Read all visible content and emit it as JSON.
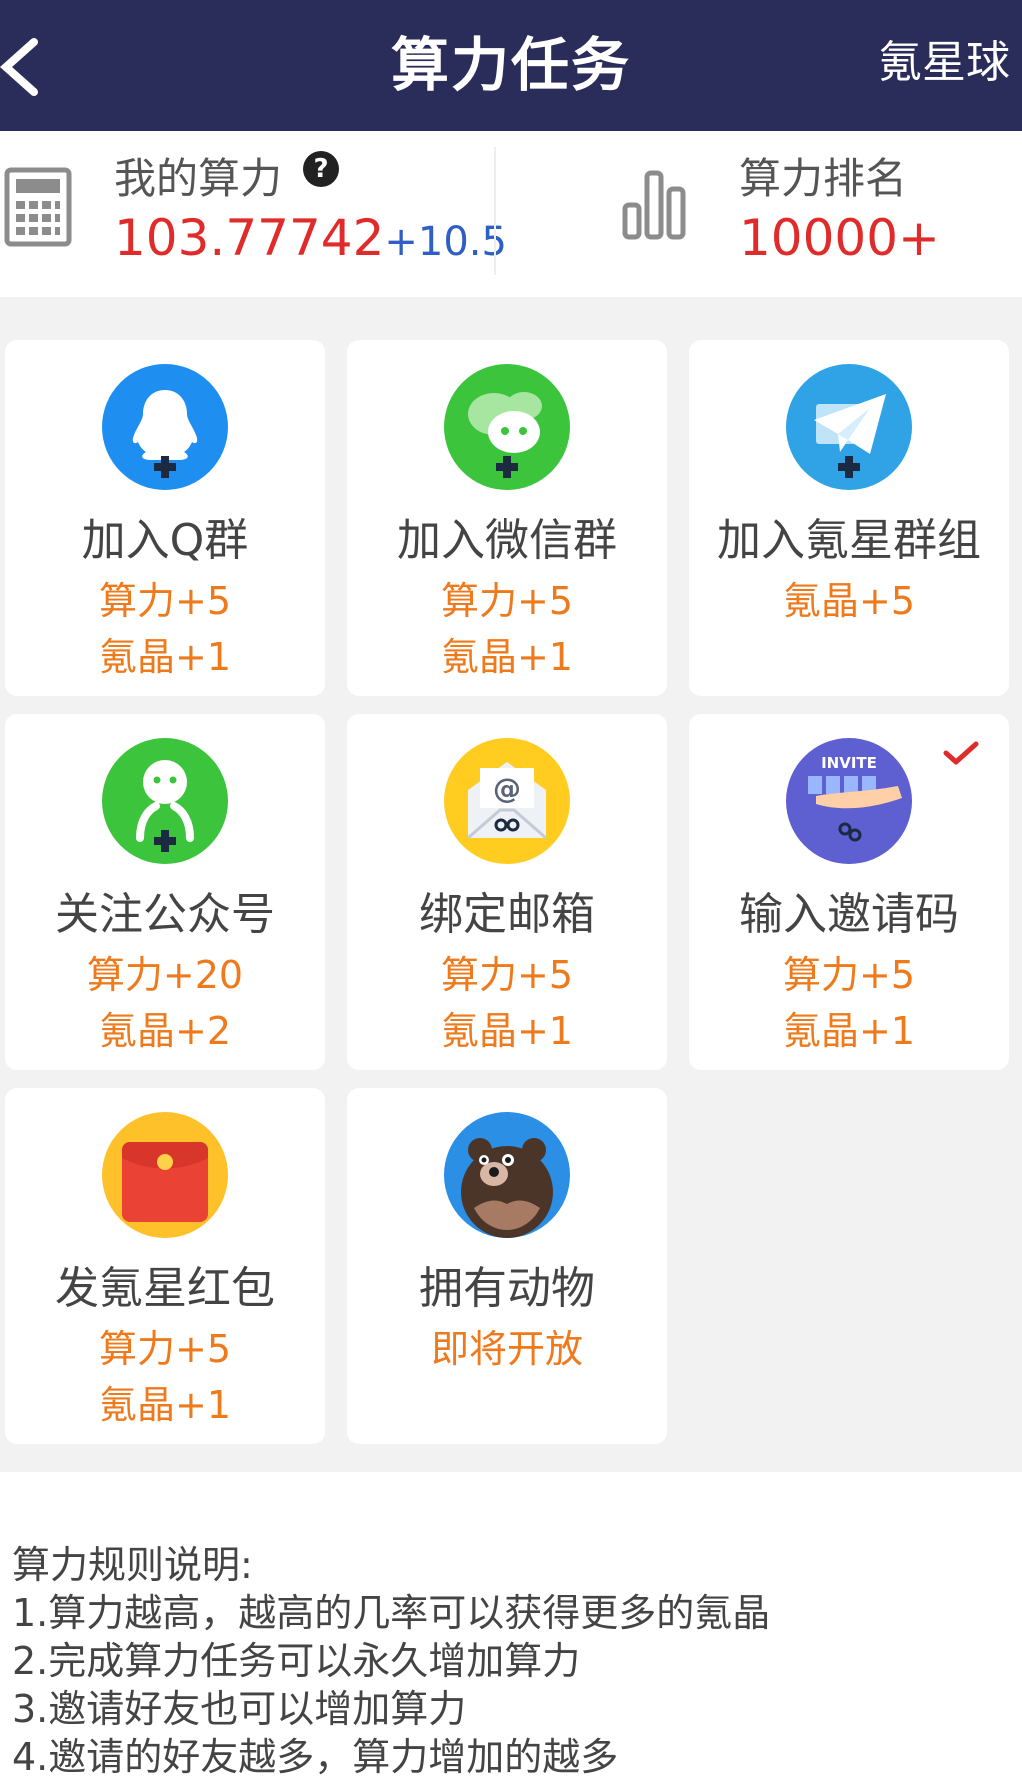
{
  "header": {
    "title": "算力任务",
    "brand": "氪星球"
  },
  "stats": {
    "power_label": "我的算力",
    "power_value": "103.77742",
    "power_increase": "+10.5",
    "rank_label": "算力排名",
    "rank_value": "10000+"
  },
  "tasks": [
    {
      "name": "加入Q群",
      "reward1": "算力+5",
      "reward2": "氪晶+1",
      "icon": "qq-group-icon"
    },
    {
      "name": "加入微信群",
      "reward1": "算力+5",
      "reward2": "氪晶+1",
      "icon": "wechat-group-icon"
    },
    {
      "name": "加入氪星群组",
      "reward1": "氪晶+5",
      "reward2": "",
      "icon": "telegram-icon"
    },
    {
      "name": "关注公众号",
      "reward1": "算力+20",
      "reward2": "氪晶+2",
      "icon": "wechat-official-icon"
    },
    {
      "name": "绑定邮箱",
      "reward1": "算力+5",
      "reward2": "氪晶+1",
      "icon": "email-icon"
    },
    {
      "name": "输入邀请码",
      "reward1": "算力+5",
      "reward2": "氪晶+1",
      "icon": "invite-icon",
      "completed": true
    },
    {
      "name": "发氪星红包",
      "reward1": "算力+5",
      "reward2": "氪晶+1",
      "icon": "red-envelope-icon"
    },
    {
      "name": "拥有动物",
      "reward1": "即将开放",
      "reward2": "",
      "icon": "bear-icon"
    }
  ],
  "rules": {
    "title": "算力规则说明:",
    "items": [
      "1.算力越高，越高的几率可以获得更多的氪晶",
      "2.完成算力任务可以永久增加算力",
      "3.邀请好友也可以增加算力",
      "4.邀请的好友越多，算力增加的越多"
    ]
  },
  "colors": {
    "header_bg": "#2a2d5a",
    "power_value": "#e02b2b",
    "power_increase": "#2f5fc4",
    "reward": "#ee7a1c",
    "page_bg": "#f2f2f2"
  }
}
